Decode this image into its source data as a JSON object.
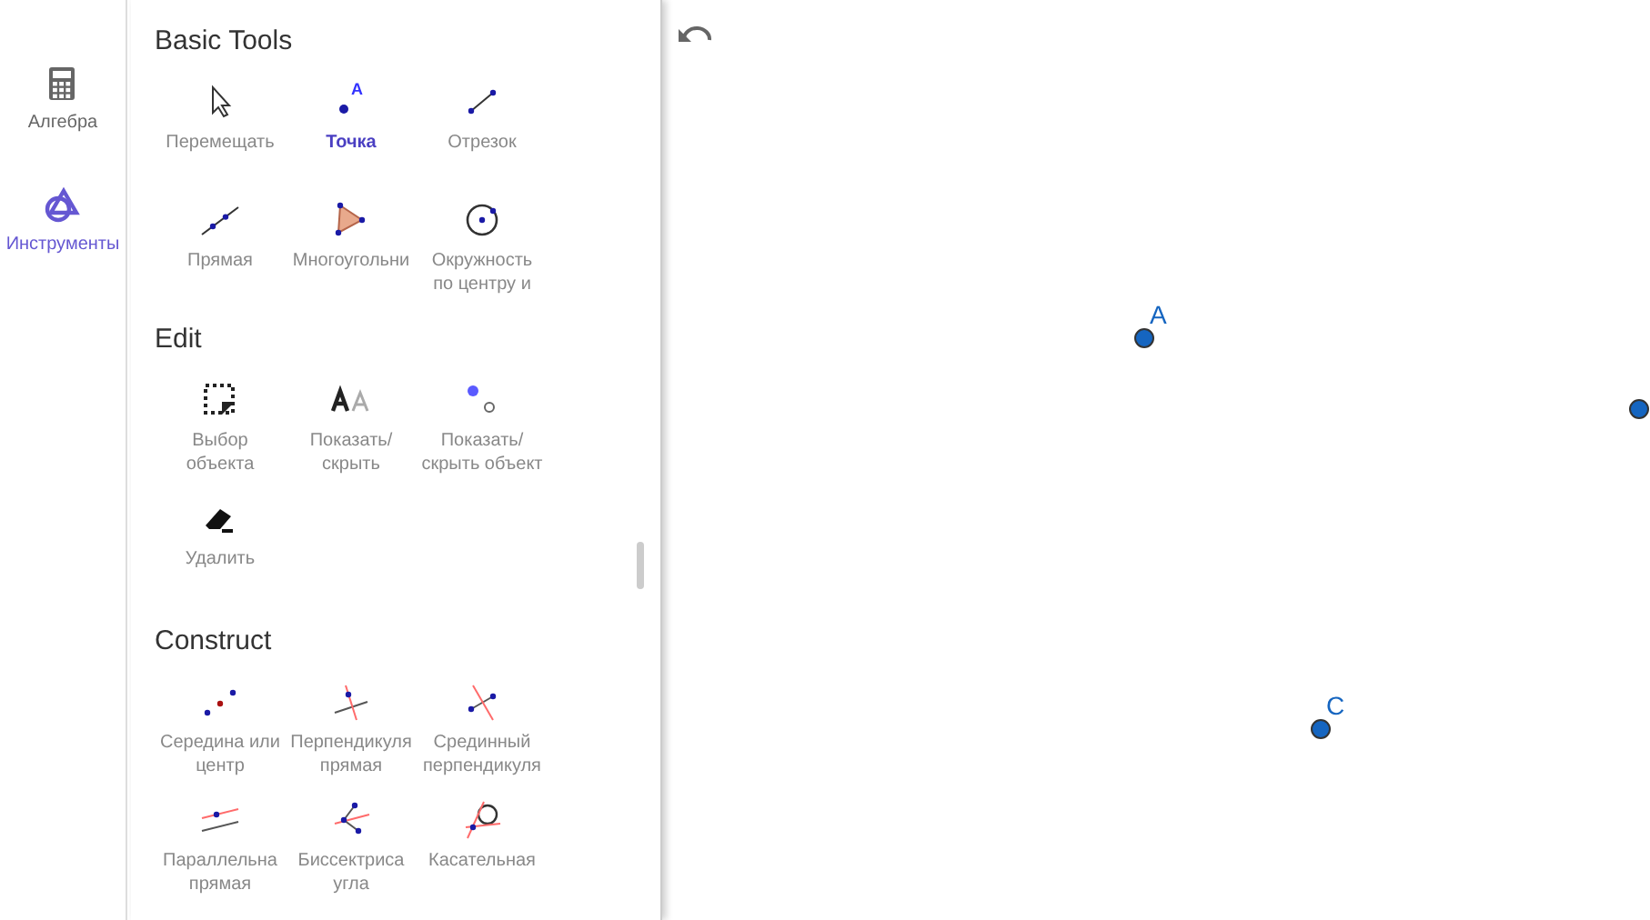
{
  "rail": [
    {
      "label": "Алгебра",
      "selected": false
    },
    {
      "label": "Инструменты",
      "selected": true
    }
  ],
  "sections": [
    {
      "title": "Basic Tools",
      "tools": [
        {
          "lines": [
            "Перемещать"
          ],
          "selected": false
        },
        {
          "lines": [
            "Точка"
          ],
          "selected": true,
          "icon_letter": "A"
        },
        {
          "lines": [
            "Отрезок"
          ],
          "selected": false
        },
        {
          "lines": [
            "Прямая"
          ],
          "selected": false
        },
        {
          "lines": [
            "Многоугольни"
          ],
          "selected": false
        },
        {
          "lines": [
            "Окружность",
            "по центру и"
          ],
          "selected": false
        }
      ]
    },
    {
      "title": "Edit",
      "tools": [
        {
          "lines": [
            "Выбор",
            "объекта"
          ],
          "selected": false
        },
        {
          "lines": [
            "Показать/",
            "скрыть"
          ],
          "selected": false
        },
        {
          "lines": [
            "Показать/",
            "скрыть объект"
          ],
          "selected": false
        },
        {
          "lines": [
            "Удалить"
          ],
          "selected": false
        }
      ]
    },
    {
      "title": "Construct",
      "tools": [
        {
          "lines": [
            "Середина или",
            "центр"
          ],
          "selected": false
        },
        {
          "lines": [
            "Перпендикуля",
            "прямая"
          ],
          "selected": false
        },
        {
          "lines": [
            "Срединный",
            "перпендикуля"
          ],
          "selected": false
        },
        {
          "lines": [
            "Параллельна",
            "прямая"
          ],
          "selected": false
        },
        {
          "lines": [
            "Биссектриса",
            "угла"
          ],
          "selected": false
        },
        {
          "lines": [
            "Касательная"
          ],
          "selected": false
        }
      ]
    }
  ],
  "points": [
    {
      "kind": "labeled",
      "label": "A"
    },
    {
      "kind": "unlabeled"
    },
    {
      "kind": "labeled",
      "label": "C"
    }
  ]
}
